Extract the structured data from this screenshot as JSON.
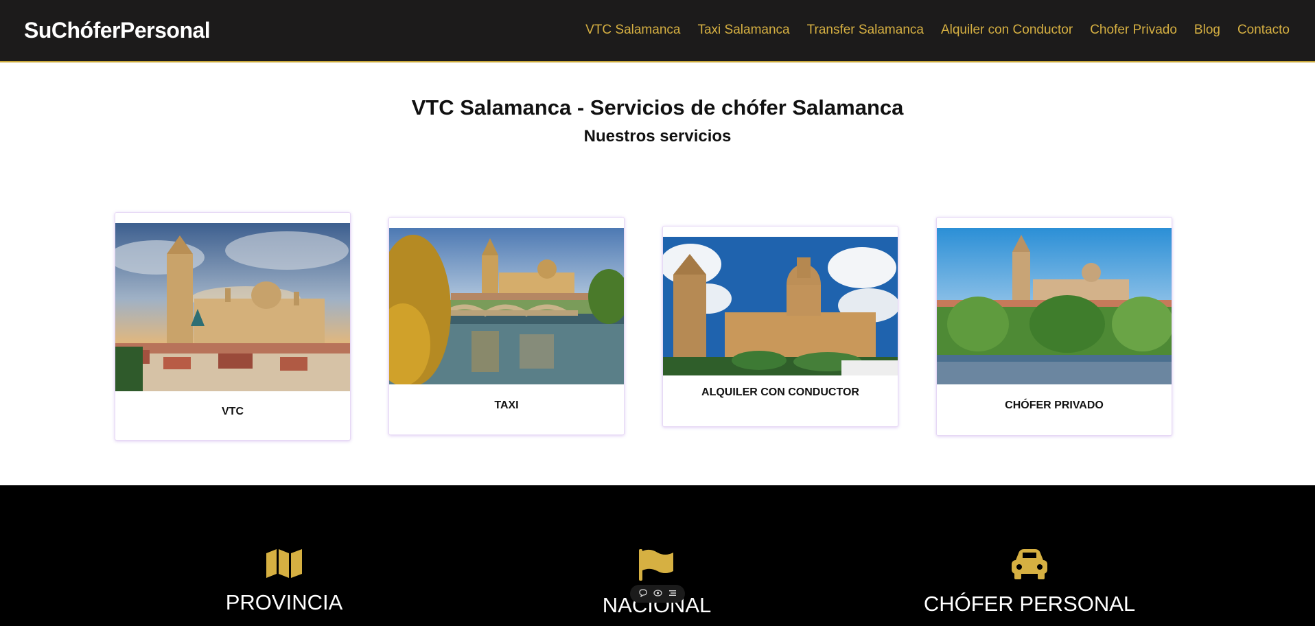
{
  "header": {
    "logo": "SuChóferPersonal",
    "nav": [
      "VTC Salamanca",
      "Taxi Salamanca",
      "Transfer Salamanca",
      "Alquiler con Conductor",
      "Chofer Privado",
      "Blog",
      "Contacto"
    ]
  },
  "main": {
    "title": "VTC Salamanca - Servicios de chófer Salamanca",
    "subtitle": "Nuestros servicios"
  },
  "cards": [
    {
      "label": "VTC",
      "image": "segovia-cathedral-photo"
    },
    {
      "label": "TAXI",
      "image": "salamanca-bridge-river-photo"
    },
    {
      "label": "ALQUILER CON CONDUCTOR",
      "image": "salamanca-cathedral-domes-photo"
    },
    {
      "label": "CHÓFER PRIVADO",
      "image": "salamanca-skyline-river-photo"
    }
  ],
  "features": [
    {
      "label": "PROVINCIA",
      "icon": "map-icon"
    },
    {
      "label": "NACIONAL",
      "icon": "flag-icon"
    },
    {
      "label": "CHÓFER PERSONAL",
      "icon": "car-icon"
    }
  ],
  "toolbar": {
    "icons": [
      "comment-icon",
      "eye-icon",
      "list-icon"
    ]
  },
  "colors": {
    "accent": "#d6b042",
    "header_bg": "#1c1b1b",
    "section_bg": "#000000"
  }
}
